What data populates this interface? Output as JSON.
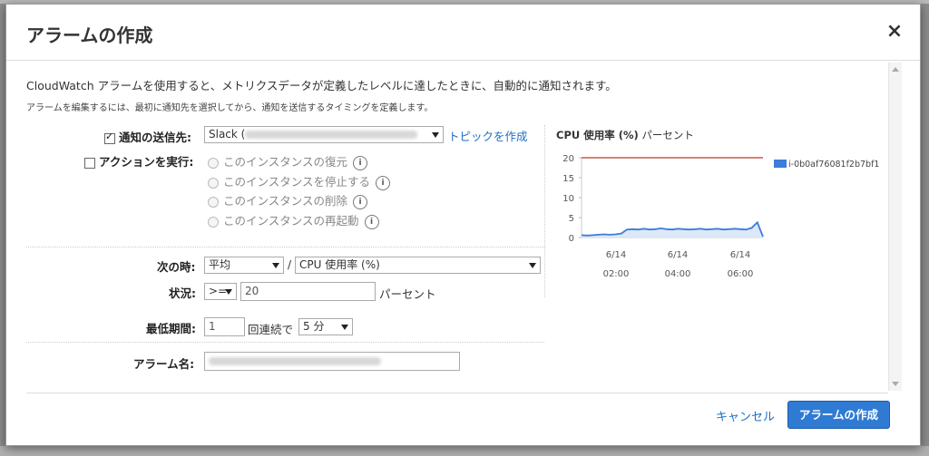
{
  "dialog": {
    "title": "アラームの作成",
    "close_symbol": "×",
    "intro": "CloudWatch アラームを使用すると、メトリクスデータが定義したレベルに達したときに、自動的に通知されます。",
    "subintro": "アラームを編集するには、最初に通知先を選択してから、通知を送信するタイミングを定義します。"
  },
  "notify": {
    "label": "通知の送信先:",
    "checked": true,
    "select_value": "Slack (",
    "create_topic_link": "トピックを作成"
  },
  "actions": {
    "label": "アクションを実行:",
    "checked": false,
    "options": [
      {
        "label": "このインスタンスの復元",
        "info": "i"
      },
      {
        "label": "このインスタンスを停止する",
        "info": "i"
      },
      {
        "label": "このインスタンスの削除",
        "info": "i"
      },
      {
        "label": "このインスタンスの再起動",
        "info": "i"
      }
    ]
  },
  "condition": {
    "when_label": "次の時:",
    "statistic": "平均",
    "slash": "/",
    "metric": "CPU 使用率 (%)",
    "state_label": "状況:",
    "operator": ">=",
    "threshold": "20",
    "threshold_unit": "パーセント",
    "period_label": "最低期間:",
    "consecutive": "1",
    "consecutive_suffix": "回連続で",
    "period": "5 分"
  },
  "alarm_name": {
    "label": "アラーム名:"
  },
  "chart_data": {
    "type": "line",
    "title": "CPU 使用率 (%)",
    "title_unit": "パーセント",
    "yticks": [
      "20",
      "15",
      "10",
      "5",
      "0"
    ],
    "ylim": [
      0,
      20
    ],
    "xticks": [
      {
        "date": "6/14",
        "time": "02:00"
      },
      {
        "date": "6/14",
        "time": "04:00"
      },
      {
        "date": "6/14",
        "time": "06:00"
      }
    ],
    "threshold": 20,
    "threshold_color": "#c0392b",
    "series": [
      {
        "name": "i-0b0af76081f2b7bf1",
        "color": "#3b7dd8",
        "values": [
          0.6,
          0.5,
          0.6,
          0.7,
          0.8,
          0.7,
          0.8,
          1.0,
          2.0,
          2.1,
          2.0,
          2.2,
          2.0,
          2.1,
          2.3,
          2.1,
          2.0,
          2.2,
          2.1,
          2.0,
          2.1,
          2.2,
          2.0,
          2.1,
          2.2,
          2.0,
          2.1,
          2.2,
          2.1,
          2.0,
          2.4,
          3.8,
          0.2
        ]
      }
    ]
  },
  "footer": {
    "cancel": "キャンセル",
    "create": "アラームの作成"
  }
}
